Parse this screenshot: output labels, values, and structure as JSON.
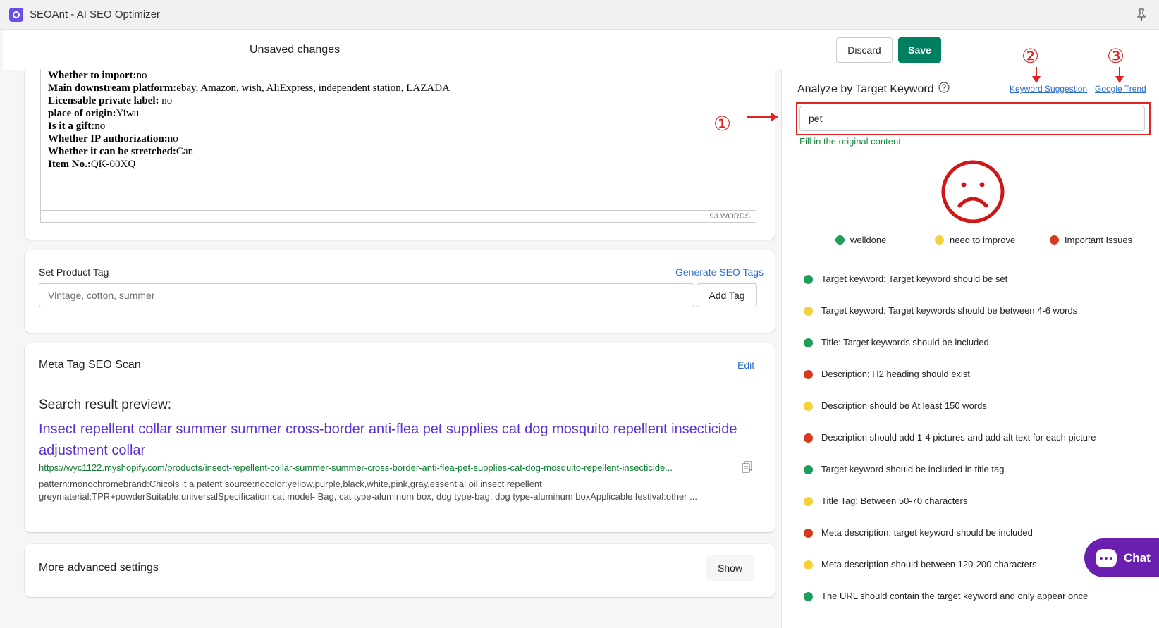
{
  "app": {
    "title": "SEOAnt - AI SEO Optimizer"
  },
  "savebar": {
    "message": "Unsaved changes",
    "discard_label": "Discard",
    "save_label": "Save"
  },
  "editor": {
    "lines": [
      {
        "label": "Whether to import:",
        "value": "no"
      },
      {
        "label": "Main downstream platform:",
        "value": "ebay, Amazon, wish, AliExpress, independent station, LAZADA"
      },
      {
        "label": "Licensable private label:",
        "value": " no"
      },
      {
        "label": "place of origin:",
        "value": "Yiwu"
      },
      {
        "label": "Is it a gift:",
        "value": "no"
      },
      {
        "label": "Whether IP authorization:",
        "value": "no"
      },
      {
        "label": "Whether it can be stretched:",
        "value": "Can"
      },
      {
        "label": "Item No.:",
        "value": "QK-00XQ"
      }
    ],
    "word_count": "93 WORDS"
  },
  "product_tag": {
    "label": "Set Product Tag",
    "generate_label": "Generate SEO Tags",
    "placeholder": "Vintage, cotton, summer",
    "add_label": "Add Tag"
  },
  "meta_scan": {
    "title": "Meta Tag SEO Scan",
    "edit_label": "Edit",
    "preview_label": "Search result preview:",
    "preview_title": "Insect repellent collar summer summer cross-border anti-flea pet supplies cat dog mosquito repellent insecticide adjustment collar",
    "preview_url": "https://wyc1122.myshopify.com/products/insect-repellent-collar-summer-summer-cross-border-anti-flea-pet-supplies-cat-dog-mosquito-repellent-insecticide...",
    "preview_desc_line1": "pattern:monochromebrand:Chicols it a patent source:nocolor:yellow,purple,black,white,pink,gray,essential oil insect repellent",
    "preview_desc_line2": "greymaterial:TPR+powderSuitable:universalSpecification:cat model- Bag, cat type-aluminum box, dog type-bag, dog type-aluminum boxApplicable festival:other ..."
  },
  "advanced": {
    "label": "More advanced settings",
    "show_label": "Show"
  },
  "analyze": {
    "title": "Analyze by Target Keyword",
    "keyword_suggestion": "Keyword Suggestion",
    "google_trend": "Google Trend",
    "keyword_value": "pet",
    "fill_original": "Fill in the original content",
    "legend": [
      {
        "label": "welldone",
        "color": "#1e9e5a"
      },
      {
        "label": "need to improve",
        "color": "#f2d13a"
      },
      {
        "label": "Important Issues",
        "color": "#d63a1e"
      }
    ],
    "checks": [
      {
        "text": "Target keyword: Target keyword should be set",
        "status": "good"
      },
      {
        "text": "Target keyword: Target keywords should be between 4-6 words",
        "status": "warn"
      },
      {
        "text": "Title: Target keywords should be included",
        "status": "good"
      },
      {
        "text": "Description: H2 heading should exist",
        "status": "bad"
      },
      {
        "text": "Description should be At least 150 words",
        "status": "warn"
      },
      {
        "text": "Description should add 1-4 pictures and add alt text for each picture",
        "status": "bad"
      },
      {
        "text": "Target keyword should be included in title tag",
        "status": "good"
      },
      {
        "text": "Title Tag: Between 50-70 characters",
        "status": "warn"
      },
      {
        "text": "Meta description: target keyword should be included",
        "status": "bad"
      },
      {
        "text": "Meta description should between 120-200 characters",
        "status": "warn"
      },
      {
        "text": "The URL should contain the target keyword and only appear once",
        "status": "good"
      }
    ]
  },
  "annotations": {
    "one": "①",
    "two": "②",
    "three": "③"
  },
  "chat": {
    "label": "Chat"
  },
  "colors": {
    "good": "#1e9e5a",
    "warn": "#f2d13a",
    "bad": "#d63a1e",
    "accent": "#008060",
    "annotation": "#e02424"
  }
}
